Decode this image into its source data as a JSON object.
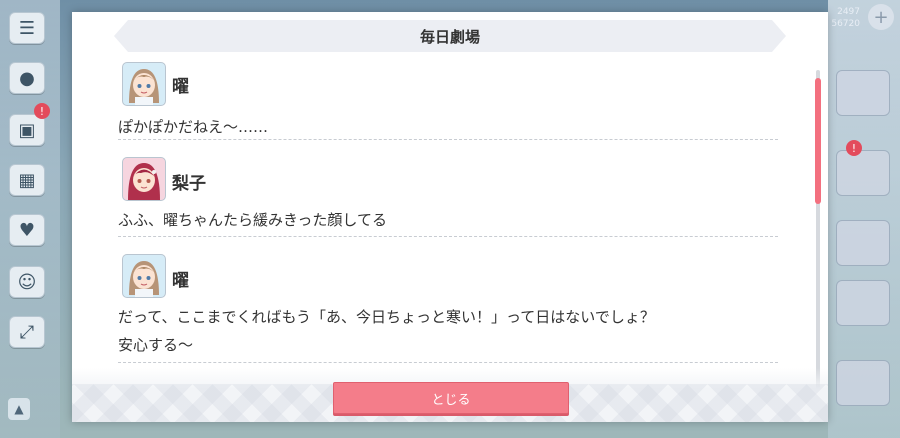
{
  "dialog": {
    "title": "毎日劇場",
    "close_label": "とじる"
  },
  "entries": [
    {
      "speaker": "曜",
      "lines": [
        "ぽかぽかだねえ〜……"
      ]
    },
    {
      "speaker": "梨子",
      "lines": [
        "ふふ、曜ちゃんたら緩みきった顔してる"
      ]
    },
    {
      "speaker": "曜",
      "lines": [
        "だって、ここまでくればもう「あ、今日ちょっと寒い！」って日はないでしょ？",
        "安心する〜"
      ]
    }
  ],
  "background": {
    "top_stats": [
      "2497",
      "56720"
    ],
    "side_badge": "!",
    "right_badge": "!"
  },
  "colors": {
    "accent": "#f47d8a",
    "scroll_thumb": "#f3707f",
    "title_bar": "#eceef3"
  }
}
